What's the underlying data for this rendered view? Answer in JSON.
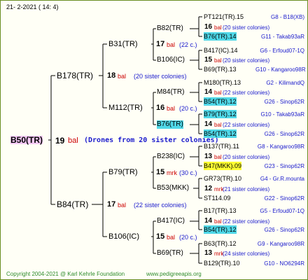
{
  "header": {
    "date": "21-  2-2021  ( 14:  4)"
  },
  "root": {
    "name": "B50(TR)",
    "num": "19",
    "suffix": "bal",
    "note": "(Drones from 20 sister colonies)"
  },
  "gen1": [
    {
      "name": "B178(TR)",
      "num": "18",
      "suffix": "bal",
      "note": "(20 sister colonies)"
    },
    {
      "name": "B84(TR)",
      "num": "17",
      "suffix": "bal",
      "note": "(22 sister colonies)"
    }
  ],
  "gen2": [
    {
      "name": "B31(TR)",
      "num": "17",
      "suffix": "bal",
      "note": "(22 c.)"
    },
    {
      "name": "M112(TR)",
      "num": "16",
      "suffix": "bal",
      "note": "(20 c.)"
    },
    {
      "name": "B79(TR)",
      "num": "15",
      "suffix": "mrk",
      "note": "(30 c.)"
    },
    {
      "name": "B106(IC)",
      "num": "15",
      "suffix": "bal",
      "note": "(20 c.)"
    }
  ],
  "gen3": [
    {
      "name": "B82(TR)",
      "num": "16",
      "suffix": "bal",
      "note": "(20 sister colonies)"
    },
    {
      "name": "B106(IC)",
      "num": "15",
      "suffix": "bal",
      "note": "(20 sister colonies)"
    },
    {
      "name": "M84(TR)",
      "num": "14",
      "suffix": "bal",
      "note": "(22 sister colonies)"
    },
    {
      "name": "B76(TR)",
      "num": "14",
      "suffix": "bal",
      "note": "(22 sister colonies)"
    },
    {
      "name": "B238(IC)",
      "num": "13",
      "suffix": "bal",
      "note": "(20 sister colonies)"
    },
    {
      "name": "B53(MKK)",
      "num": "12",
      "suffix": "mrk",
      "note": "(21 sister colonies)"
    },
    {
      "name": "B417(IC)",
      "num": "14",
      "suffix": "bal",
      "note": "(22 sister colonies)"
    },
    {
      "name": "B69(TR)",
      "num": "13",
      "suffix": "mrk",
      "note": "(24 sister colonies)"
    }
  ],
  "gen4": [
    {
      "name": "PT121(TR).15",
      "id": "G8 - B18(XB)"
    },
    {
      "name": "B76(TR).14",
      "id": "G11 - Takab93aR"
    },
    {
      "name": "B417(IC).14",
      "id": "G6 - Erfoud07-1Q"
    },
    {
      "name": "B69(TR).13",
      "id": "G10 - Kangaroo98R"
    },
    {
      "name": "M180(TR).13",
      "id": "G2 - KilimandQ"
    },
    {
      "name": "B54(TR).12",
      "id": "G26 - Sinop62R"
    },
    {
      "name": "B79(TR).12",
      "id": "G10 - Takab93aR"
    },
    {
      "name": "B54(TR).12",
      "id": "G26 - Sinop62R"
    },
    {
      "name": "B137(TR).11",
      "id": "G8 - Kangaroo98R"
    },
    {
      "name": "B47(MKK).09",
      "id": "G23 - Sinop62R"
    },
    {
      "name": "GR73(TR).10",
      "id": "G4 - Gr.R.mounta"
    },
    {
      "name": "ST114.09",
      "id": "G22 - Sinop62R"
    },
    {
      "name": "B17(TR).13",
      "id": "G5 - Erfoud07-1Q"
    },
    {
      "name": "B54(TR).12",
      "id": "G26 - Sinop62R"
    },
    {
      "name": "B63(TR).12",
      "id": "G9 - Kangaroo98R"
    },
    {
      "name": "B129(TR).10",
      "id": "G10 - NO6294R"
    }
  ],
  "footer": {
    "copyright": "Copyright 2004-2021 @ Karl Kehrle Foundation",
    "site": "www.pedigreeapis.org"
  }
}
